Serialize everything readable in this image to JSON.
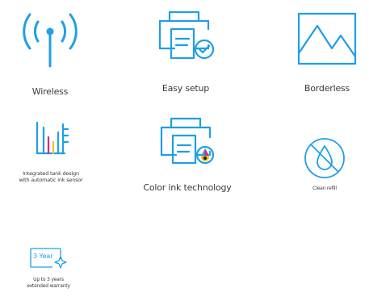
{
  "theme": {
    "icon_blue": "#1e9fe6",
    "accent_yellow": "#f5c518",
    "accent_pink": "#e0218a",
    "accent_cyan": "#1e9fe6",
    "text_color": "#3a3a3a"
  },
  "features": {
    "wireless": {
      "icon": "wireless-antenna-icon",
      "label": "Wireless"
    },
    "easy_setup": {
      "icon": "printer-check-icon",
      "label": "Easy setup"
    },
    "borderless": {
      "icon": "mountain-landscape-icon",
      "label": "Borderless"
    },
    "tank": {
      "icon": "ink-tank-level-icon",
      "label_line1": "Integrated tank design",
      "label_line2": "with automatic ink sensor"
    },
    "color_ink": {
      "icon": "printer-color-drop-icon",
      "label": "Color ink technology"
    },
    "clean_refill": {
      "icon": "no-spill-drop-icon",
      "label": "Clean refill"
    },
    "warranty": {
      "icon": "warranty-badge-icon",
      "badge_text": "3 Year",
      "label_line1": "Up to 3 years",
      "label_line2": "extended warranty"
    }
  }
}
